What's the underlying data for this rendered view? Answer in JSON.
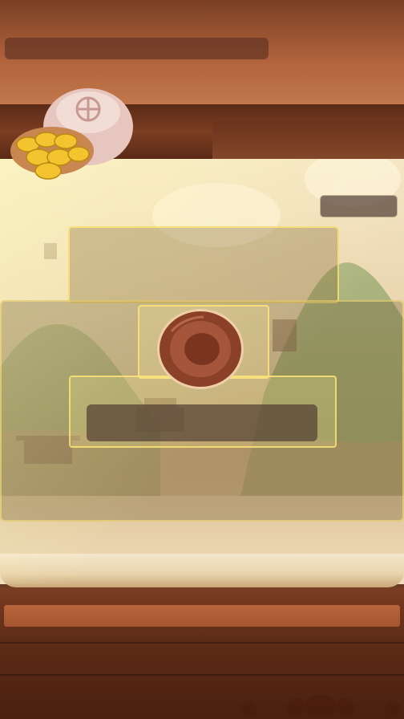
{
  "colors": {
    "wood_dark": "#5e2c16",
    "wood_mid": "#a55530",
    "scroll_paper": "#ead6b0",
    "frame_gold": "#ffe678",
    "placeholder_bar": "#50403a",
    "avatar_brown": "#7a3a25"
  },
  "icons": {
    "gold_bag": "gold-ingot-bag-icon",
    "avatar": "bowl-avatar-icon",
    "ornament": "cloud-ornament-icon"
  }
}
